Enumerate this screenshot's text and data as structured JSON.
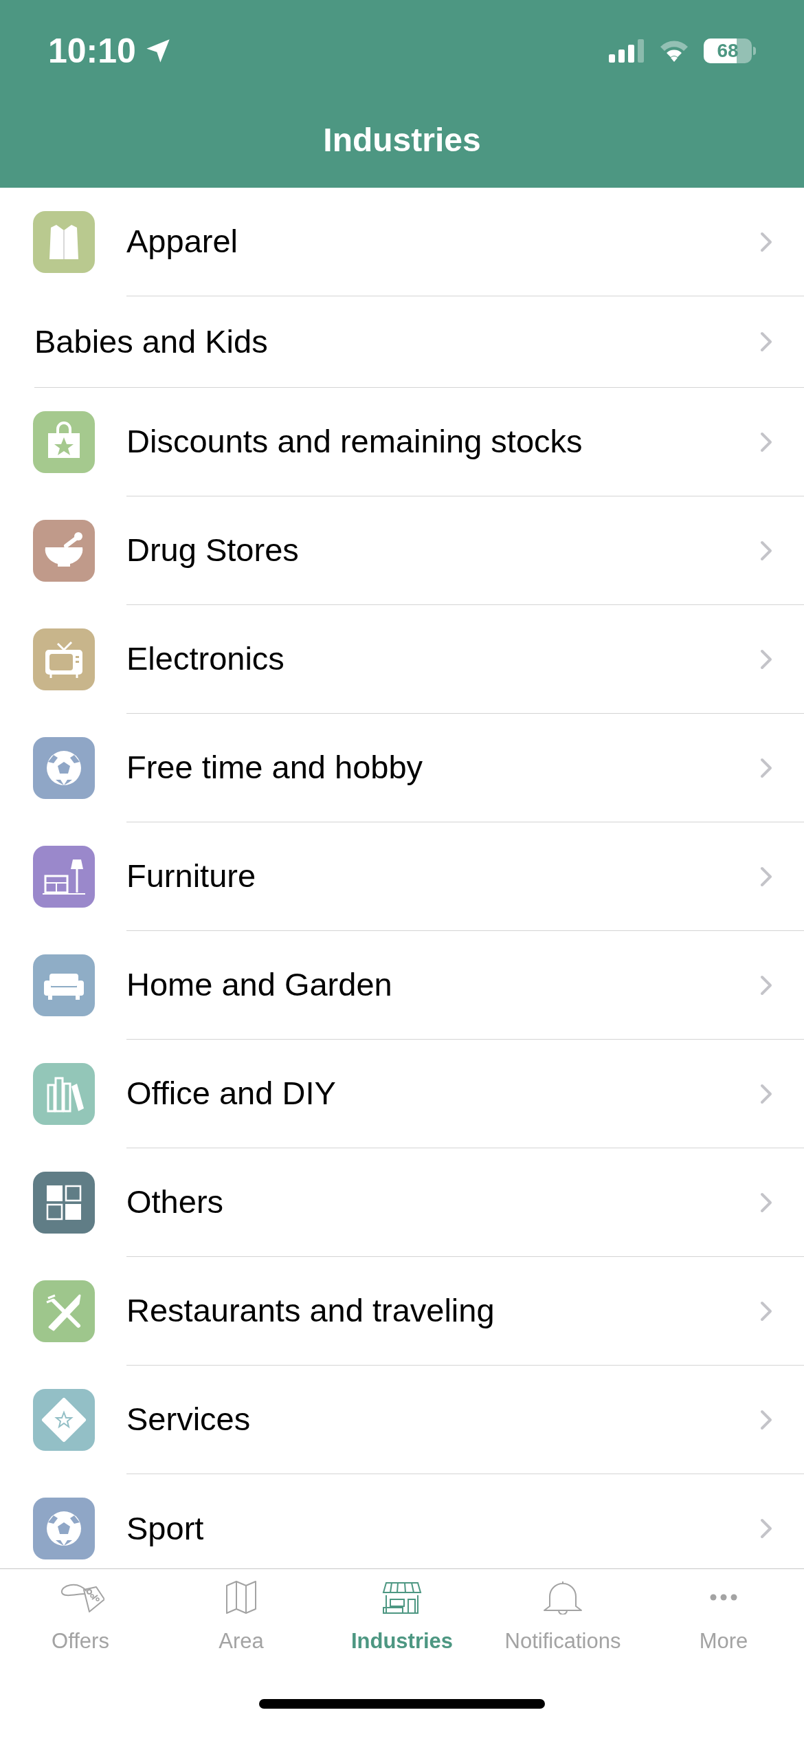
{
  "status_bar": {
    "time": "10:10",
    "battery": "68"
  },
  "header": {
    "title": "Industries"
  },
  "industries": [
    {
      "label": "Apparel",
      "kind": "coat",
      "color": "#b9c98f"
    },
    {
      "label": "Babies and Kids"
    },
    {
      "label": "Discounts and remaining stocks",
      "kind": "bag",
      "color": "#a5c98e"
    },
    {
      "label": "Drug Stores",
      "kind": "mortar",
      "color": "#c09a8a"
    },
    {
      "label": "Electronics",
      "kind": "tv",
      "color": "#c8b58b"
    },
    {
      "label": "Free time and hobby",
      "kind": "ball",
      "color": "#8fa6c6"
    },
    {
      "label": "Furniture",
      "kind": "furniture",
      "color": "#9a88cb"
    },
    {
      "label": "Home and Garden",
      "kind": "sofa",
      "color": "#8fadc6"
    },
    {
      "label": "Office and DIY",
      "kind": "books",
      "color": "#93c6b8"
    },
    {
      "label": "Others",
      "kind": "grid",
      "color": "#607d86"
    },
    {
      "label": "Restaurants and traveling",
      "kind": "cutlery",
      "color": "#9ec68c"
    },
    {
      "label": "Services",
      "kind": "ticket",
      "color": "#93bfc6"
    },
    {
      "label": "Sport",
      "kind": "ball",
      "color": "#8fa6c6"
    }
  ],
  "tab_bar": [
    {
      "label": "Offers",
      "kind": "tag",
      "selected": false
    },
    {
      "label": "Area",
      "kind": "map",
      "selected": false
    },
    {
      "label": "Industries",
      "kind": "store",
      "selected": true
    },
    {
      "label": "Notifications",
      "kind": "bell",
      "selected": false
    },
    {
      "label": "More",
      "kind": "dots",
      "selected": false
    }
  ]
}
